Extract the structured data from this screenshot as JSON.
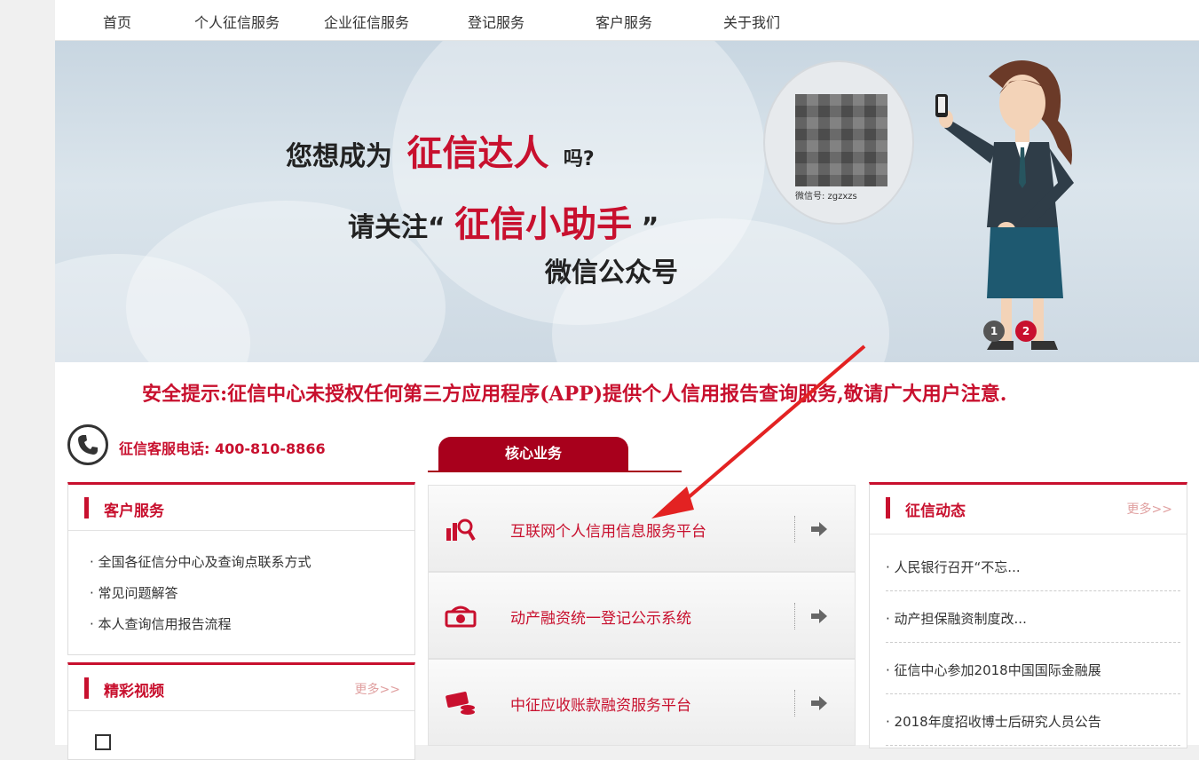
{
  "nav": {
    "items": [
      "首页",
      "个人征信服务",
      "企业征信服务",
      "登记服务",
      "客户服务",
      "关于我们"
    ]
  },
  "banner": {
    "line1_a": "您想成为",
    "line1_b": "征信达人",
    "line1_c": "吗?",
    "line2_a": "请关注“",
    "line2_b": "征信小助手",
    "line2_c": "”",
    "line3": "微信公众号",
    "qr_label": "微信号: zgzxzs",
    "dot1": "1",
    "dot2": "2",
    "colors": {
      "accent": "#c8102e",
      "dot_active": "#c8102e",
      "dot_inactive": "#555555"
    }
  },
  "notice": "安全提示:征信中心未授权任何第三方应用程序(APP)提供个人信用报告查询服务,敬请广大用户注意.",
  "hotline": {
    "text": "征信客服电话: 400-810-8866"
  },
  "core": {
    "tab_label": "核心业务",
    "services": [
      {
        "label": "互联网个人信用信息服务平台",
        "icon": "chart-search-icon"
      },
      {
        "label": "动产融资统一登记公示系统",
        "icon": "money-icon"
      },
      {
        "label": "中征应收账款融资服务平台",
        "icon": "card-coins-icon"
      }
    ]
  },
  "customer_service": {
    "title": "客户服务",
    "items": [
      "· 全国各征信分中心及查询点联系方式",
      "· 常见问题解答",
      "· 本人查询信用报告流程"
    ]
  },
  "videos": {
    "title": "精彩视频",
    "more": "更多>>"
  },
  "news": {
    "title": "征信动态",
    "more": "更多>>",
    "items": [
      "· 人民银行召开“不忘...",
      "· 动产担保融资制度改...",
      "· 征信中心参加2018中国国际金融展",
      "· 2018年度招收博士后研究人员公告"
    ]
  }
}
